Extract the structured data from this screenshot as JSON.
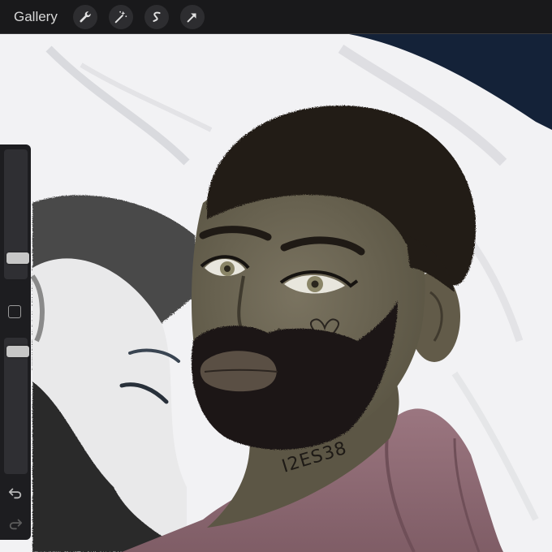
{
  "toolbar": {
    "gallery_label": "Gallery",
    "tools": [
      {
        "name": "actions",
        "icon": "wrench-icon"
      },
      {
        "name": "adjustments",
        "icon": "magic-wand-icon"
      },
      {
        "name": "selection",
        "icon": "selection-s-icon"
      },
      {
        "name": "transform",
        "icon": "arrow-cursor-icon"
      }
    ]
  },
  "sidebar": {
    "brush_size_level": 0.12,
    "opacity_level": 0.95,
    "modify_button": "square-icon",
    "undo": "undo-arrow-icon",
    "redo": "redo-arrow-icon"
  },
  "artwork": {
    "neck_tattoo": "I2ES38",
    "colors": {
      "background_navy": "#142238",
      "sheets": "#f3f3f5",
      "skin": "#6b6554",
      "hair": "#231d18",
      "shirt": "#8f6a74",
      "toolbar": "#19191b"
    }
  }
}
